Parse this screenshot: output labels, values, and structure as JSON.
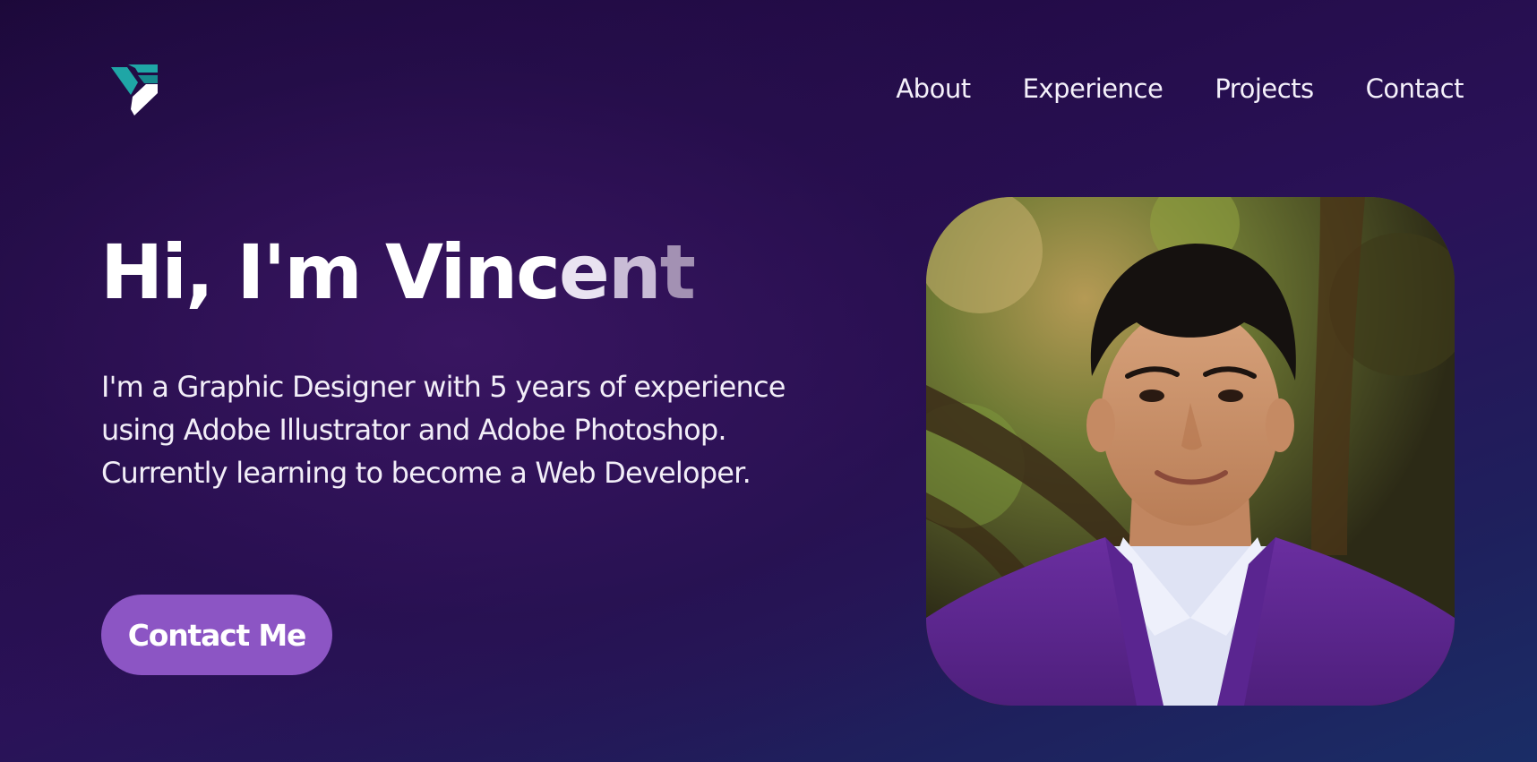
{
  "brand": {
    "logo_icon": "vincent-v-logo-icon",
    "colors": {
      "teal": "#1fa6a6",
      "white": "#ffffff",
      "accent": "#8c55c4"
    }
  },
  "nav": {
    "items": [
      {
        "label": "About"
      },
      {
        "label": "Experience"
      },
      {
        "label": "Projects"
      },
      {
        "label": "Contact"
      }
    ]
  },
  "hero": {
    "title_main": "Hi, I'm Vinc",
    "title_fade_1": "e",
    "title_fade_2": "n",
    "title_fade_3": "t",
    "description": "I'm a Graphic Designer with 5 years of experience using Adobe Illustrator and Adobe Photoshop. Currently learning to become a Web Developer.",
    "cta_label": "Contact Me"
  },
  "portrait": {
    "image": "portrait-photo-of-young-man-in-purple-blazer"
  },
  "theme": {
    "background_top": "#1b0838",
    "background_mid": "#2a1258",
    "background_bottom": "#1a2d66",
    "button_color": "#8c55c4"
  }
}
